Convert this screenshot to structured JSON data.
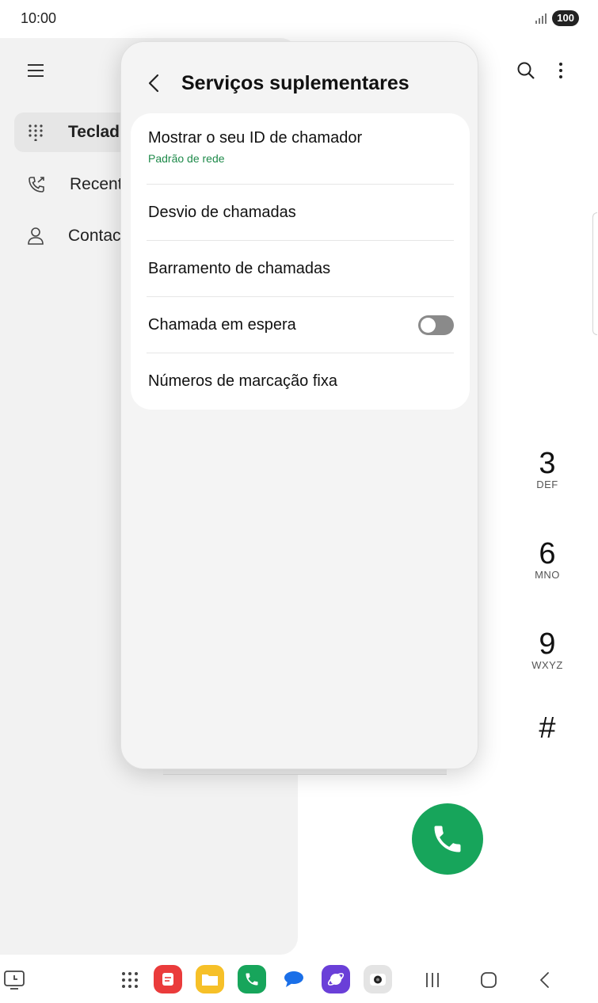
{
  "status": {
    "time": "10:00",
    "battery": "100"
  },
  "background_app": {
    "nav": [
      {
        "label": "Teclad",
        "icon": "dialpad-icon"
      },
      {
        "label": "Recent",
        "icon": "recent-calls-icon"
      },
      {
        "label": "Contac",
        "icon": "contacts-icon"
      }
    ],
    "dialpad": [
      {
        "num": "3",
        "letters": "DEF"
      },
      {
        "num": "6",
        "letters": "MNO"
      },
      {
        "num": "9",
        "letters": "WXYZ"
      },
      {
        "num": "#",
        "letters": ""
      }
    ]
  },
  "panel": {
    "title": "Serviços suplementares",
    "items": [
      {
        "label": "Mostrar o seu ID de chamador",
        "sub": "Padrão de rede"
      },
      {
        "label": "Desvio de chamadas"
      },
      {
        "label": "Barramento de chamadas"
      },
      {
        "label": "Chamada em espera",
        "toggle": "off"
      },
      {
        "label": "Números de marcação fixa"
      }
    ]
  },
  "colors": {
    "accent_green": "#17a55b",
    "sub_text_green": "#1e8a4a"
  }
}
